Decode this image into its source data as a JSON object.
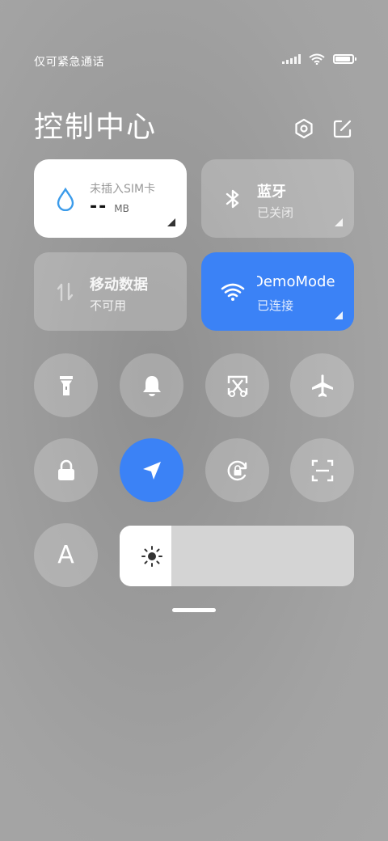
{
  "status_bar": {
    "carrier_text": "仅可紧急通话",
    "icons": [
      "signal-icon",
      "wifi-icon",
      "battery-icon"
    ],
    "battery_level": 0.9
  },
  "header": {
    "title": "控制中心",
    "icons": [
      "settings-icon",
      "edit-icon"
    ]
  },
  "tiles": {
    "data_usage": {
      "label": "未插入SIM卡",
      "value": "--",
      "unit": "MB",
      "icon": "water-drop-icon"
    },
    "bluetooth": {
      "label": "蓝牙",
      "status": "已关闭",
      "icon": "bluetooth-icon"
    },
    "mobile_data": {
      "label": "移动数据",
      "status": "不可用",
      "icon": "data-arrows-icon"
    },
    "wifi": {
      "label": "DemoMode",
      "status": "已连接",
      "icon": "wifi-icon"
    }
  },
  "toggles_row1": [
    "flashlight-icon",
    "bell-icon",
    "screenshot-icon",
    "airplane-icon"
  ],
  "toggles_row2": [
    "lock-icon",
    "location-icon",
    "rotation-lock-icon",
    "scan-icon"
  ],
  "font_button": {
    "label": "A"
  },
  "brightness": {
    "level": 0.22,
    "icon": "sun-icon"
  },
  "colors": {
    "accent": "#3b82f6",
    "tile_white": "#ffffff"
  }
}
